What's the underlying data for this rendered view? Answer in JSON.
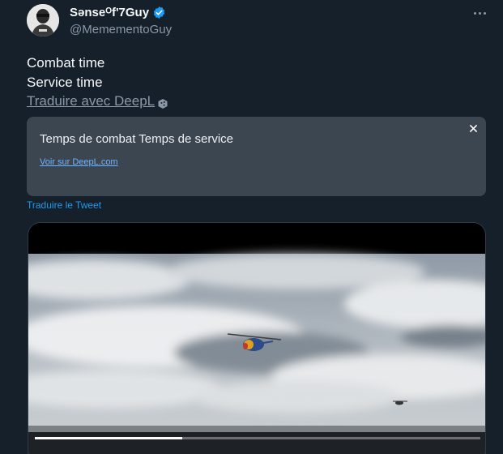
{
  "tweet": {
    "display_name": "Sənseᴼf'7Guy",
    "handle": "@MemementoGuy",
    "text_lines": [
      "Combat time",
      "Service time"
    ],
    "translate_deepl_label": "Traduire avec DeepL",
    "translation": {
      "text": "Temps de combat Temps de service",
      "link_label": "Voir sur DeepL.com"
    },
    "translate_tweet_label": "Traduire le Tweet",
    "media": {
      "type": "video",
      "progress": 0.33
    }
  },
  "colors": {
    "background": "#15202b",
    "accent": "#1d9bf0",
    "secondary_text": "#8b98a5",
    "translation_box": "#3c4650"
  }
}
